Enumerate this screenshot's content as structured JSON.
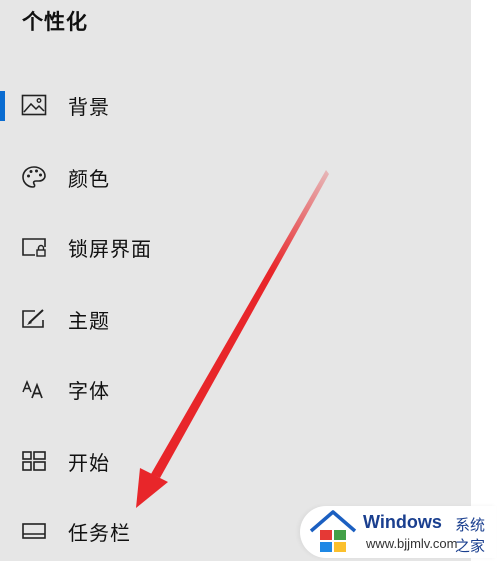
{
  "page": {
    "title": "个性化"
  },
  "nav": {
    "selected_index": 0,
    "items": [
      {
        "label": "背景",
        "icon": "picture-icon"
      },
      {
        "label": "颜色",
        "icon": "palette-icon"
      },
      {
        "label": "锁屏界面",
        "icon": "lock-screen-icon"
      },
      {
        "label": "主题",
        "icon": "theme-icon"
      },
      {
        "label": "字体",
        "icon": "font-icon"
      },
      {
        "label": "开始",
        "icon": "start-tiles-icon"
      },
      {
        "label": "任务栏",
        "icon": "taskbar-icon"
      }
    ]
  },
  "annotation": {
    "arrow_color": "#e8262a",
    "points_to": "任务栏"
  },
  "watermark": {
    "brand": "Windows",
    "brand_suffix": "系统之家",
    "url": "www.bjjmlv.com"
  },
  "colors": {
    "panel_bg": "#e6e6e6",
    "accent": "#0a6cd1",
    "text": "#111111"
  }
}
